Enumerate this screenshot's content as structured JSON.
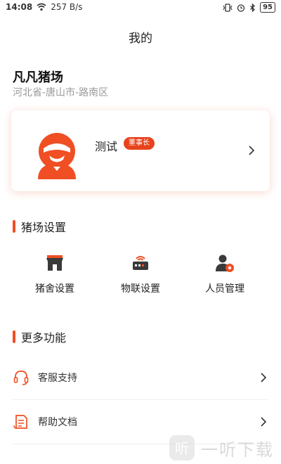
{
  "status_bar": {
    "time": "14:08",
    "net_speed": "257 B/s",
    "battery": "95"
  },
  "header": {
    "title": "我的"
  },
  "farm": {
    "name": "凡凡猪场",
    "address": "河北省-唐山市-路南区"
  },
  "profile": {
    "user_name": "测试",
    "role": "董事长"
  },
  "farm_settings": {
    "title": "猪场设置",
    "items": [
      {
        "label": "猪舍设置",
        "icon": "pig-house-icon"
      },
      {
        "label": "物联设置",
        "icon": "iot-router-icon"
      },
      {
        "label": "人员管理",
        "icon": "user-settings-icon"
      }
    ]
  },
  "more_features": {
    "title": "更多功能",
    "items": [
      {
        "label": "客服支持",
        "icon": "headset-icon"
      },
      {
        "label": "帮助文档",
        "icon": "document-icon"
      }
    ]
  },
  "watermark": {
    "text": "一听下载",
    "logo_char": "听"
  },
  "colors": {
    "accent": "#f04e23",
    "badge": "#e8431d",
    "icon_dark": "#3a3a3a"
  }
}
